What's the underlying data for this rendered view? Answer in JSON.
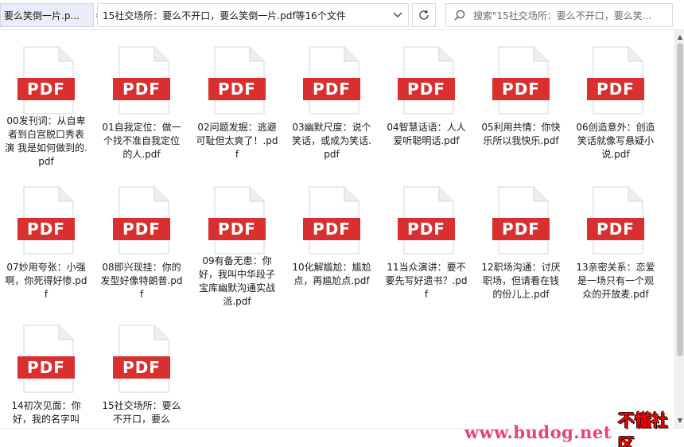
{
  "titlebar": {
    "tab_title": "要么笑倒一片.p...",
    "address": "15社交场所：要么不开口，要么笑倒一片.pdf等16个文件",
    "search_placeholder": "搜索\"15社交场所：要么不开口，要么笑..."
  },
  "files": [
    {
      "name": "00发刊词：从自卑者到白宫脱口秀表演 我是如何做到的.pdf"
    },
    {
      "name": "01自我定位：做一个找不准自我定位的人.pdf"
    },
    {
      "name": "02问题发掘：逃避可耻但太爽了！.pdf"
    },
    {
      "name": "03幽默尺度：说个笑话，或成为笑话.pdf"
    },
    {
      "name": "04智慧话语：人人爱听聪明话.pdf"
    },
    {
      "name": "05利用共情：你快乐所以我快乐.pdf"
    },
    {
      "name": "06创造意外：创造笑话就像写悬疑小说.pdf"
    },
    {
      "name": "07妙用夸张：小强啊，你死得好惨.pdf"
    },
    {
      "name": "08即兴现挂：你的发型好像特朗普.pdf"
    },
    {
      "name": "09有备无患：你好，我叫中华段子宝库幽默沟通实战派.pdf"
    },
    {
      "name": "10化解尴尬：尴尬点，再尴尬点.pdf"
    },
    {
      "name": "11当众演讲：要不要先写好遗书？.pdf"
    },
    {
      "name": "12职场沟通：讨厌职场，但请看在钱的份儿上.pdf"
    },
    {
      "name": "13亲密关系：恋爱是一场只有一个观众的开放麦.pdf"
    },
    {
      "name": "14初次见面：你好，我的名字叫"
    },
    {
      "name": "15社交场所：要么不开口，要么"
    }
  ],
  "icon": {
    "label": "PDF",
    "color": "#d9302f"
  },
  "watermark": {
    "url": "www.budog.net",
    "name": "不懂社区"
  }
}
